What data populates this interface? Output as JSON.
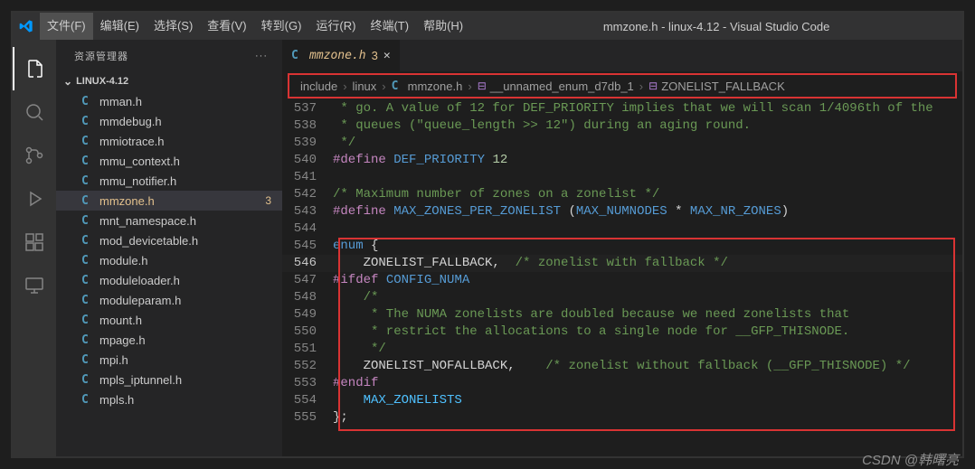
{
  "title": "mmzone.h - linux-4.12 - Visual Studio Code",
  "menu": {
    "file": "文件(F)",
    "edit": "编辑(E)",
    "select": "选择(S)",
    "view": "查看(V)",
    "goto": "转到(G)",
    "run": "运行(R)",
    "terminal": "终端(T)",
    "help": "帮助(H)"
  },
  "sidebar": {
    "title": "资源管理器",
    "more": "···",
    "section": "LINUX-4.12",
    "files": [
      {
        "name": "mman.h"
      },
      {
        "name": "mmdebug.h"
      },
      {
        "name": "mmiotrace.h"
      },
      {
        "name": "mmu_context.h"
      },
      {
        "name": "mmu_notifier.h"
      },
      {
        "name": "mmzone.h",
        "active": true,
        "badge": "3"
      },
      {
        "name": "mnt_namespace.h"
      },
      {
        "name": "mod_devicetable.h"
      },
      {
        "name": "module.h"
      },
      {
        "name": "moduleloader.h"
      },
      {
        "name": "moduleparam.h"
      },
      {
        "name": "mount.h"
      },
      {
        "name": "mpage.h"
      },
      {
        "name": "mpi.h"
      },
      {
        "name": "mpls_iptunnel.h"
      },
      {
        "name": "mpls.h"
      }
    ]
  },
  "tab": {
    "label": "mmzone.h",
    "mod": "3",
    "close": "✕",
    "icon": "C"
  },
  "breadcrumb": {
    "items": [
      {
        "label": "include"
      },
      {
        "label": "linux"
      },
      {
        "label": "mmzone.h",
        "icon": "C"
      },
      {
        "label": "__unnamed_enum_d7db_1",
        "sym": true
      },
      {
        "label": "ZONELIST_FALLBACK",
        "sym": true
      }
    ],
    "sep": "›"
  },
  "code": {
    "start": 537,
    "active": 546,
    "lines": [
      " * go. A value of 12 for DEF_PRIORITY implies that we will scan 1/4096th of the",
      " * queues (\"queue_length >> 12\") during an aging round.",
      " */",
      "#define DEF_PRIORITY 12",
      "",
      "/* Maximum number of zones on a zonelist */",
      "#define MAX_ZONES_PER_ZONELIST (MAX_NUMNODES * MAX_NR_ZONES)",
      "",
      "enum {",
      "    ZONELIST_FALLBACK,  /* zonelist with fallback */",
      "#ifdef CONFIG_NUMA",
      "    /*",
      "     * The NUMA zonelists are doubled because we need zonelists that",
      "     * restrict the allocations to a single node for __GFP_THISNODE.",
      "     */",
      "    ZONELIST_NOFALLBACK,    /* zonelist without fallback (__GFP_THISNODE) */",
      "#endif",
      "    MAX_ZONELISTS",
      "};"
    ]
  },
  "watermark": "CSDN @韩曙亮"
}
